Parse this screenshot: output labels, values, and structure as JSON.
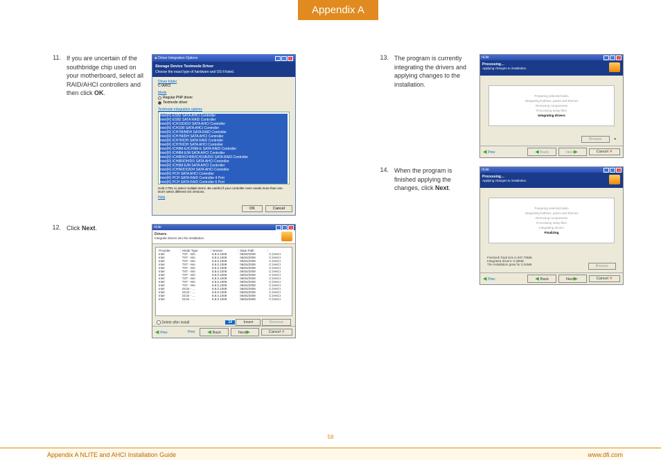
{
  "header": {
    "title": "Appendix A"
  },
  "steps": {
    "s11": {
      "num": "11.",
      "text_a": "If you are uncertain of the southbridge chip used on your motherboard, select all RAID/AHCI controllers and then click ",
      "text_b": "OK",
      "text_c": "."
    },
    "s12": {
      "num": "12.",
      "text_a": "Click ",
      "text_b": "Next",
      "text_c": "."
    },
    "s13": {
      "num": "13.",
      "text_a": "The program is currently integrating the drivers and applying changes to the installation."
    },
    "s14": {
      "num": "14.",
      "text_a": "When the program is finished applying the changes, click ",
      "text_b": "Next",
      "text_c": "."
    }
  },
  "win11": {
    "title": "Driver Integration Options",
    "h": "Storage Device Textmode Driver",
    "sub": "Choose the exact type of hardware and OS if listed.",
    "folder_lbl": "Driver folder",
    "folder": "C:\\AHCI",
    "mode_lbl": "Mode",
    "radio1": "Regular PNP driver",
    "radio2": "Textmode driver",
    "list_lbl": "Textmode integration options",
    "items": [
      "Intel(R) ESB2 SATA AHCI Controller",
      "Intel(R) ESB2 SATA RAID Controller",
      "Intel(R) ICH10D/DO SATA AHCI Controller",
      "Intel(R) ICH10R SATA AHCI Controller",
      "Intel(R) ICH7M/MDH SATA RAID Controller",
      "Intel(R) ICH7M/DH SATA AHCI Controller",
      "Intel(R) ICH7R/DH SATA RAID Controller",
      "Intel(R) ICH7R/DH SATA AHCI Controller",
      "Intel(R) ICH8M-E/ICH9M-E SATA RAID Controller",
      "Intel(R) ICH8M-E/M SATA AHCI Controller",
      "Intel(R) ICH8R/ICH9R/ICH10R/DO SATA RAID Controller",
      "Intel(R) ICH8R/DH/DO SATA AHCI Controller",
      "Intel(R) ICH9M-E/M SATA AHCI Controller",
      "Intel(R) ICH9R/DO/DH SATA AHCI Controller",
      "Intel(R) PCH SATA AHCI Controller",
      "Intel(R) PCH SATA RAID Controller 4 Port",
      "Intel(R) PCH SATA RAID Controller 6 Port"
    ],
    "hint": "Hold CTRL to select multiple items. Be careful if your controller even needs more than one. Don't select different OS versions.",
    "help": "Help",
    "ok": "OK",
    "cancel": "Cancel"
  },
  "win12": {
    "title": "nLite",
    "h": "Drivers",
    "sub": "Integrate drivers into the installation.",
    "rows": [
      [
        "Intel",
        "TXT - MA",
        "8.8.0.1009",
        "06/04/2009",
        "C:\\AHCI"
      ],
      [
        "Intel",
        "TXT - MA",
        "8.8.0.1009",
        "06/04/2009",
        "C:\\AHCI"
      ],
      [
        "Intel",
        "TXT - MA",
        "8.8.0.1009",
        "06/04/2009",
        "C:\\AHCI"
      ],
      [
        "Intel",
        "TXT - MA",
        "8.8.0.1009",
        "06/04/2009",
        "C:\\AHCI"
      ],
      [
        "Intel",
        "TXT - MA",
        "8.8.0.1009",
        "06/04/2009",
        "C:\\AHCI"
      ],
      [
        "Intel",
        "TXT - MA",
        "8.8.0.1009",
        "06/04/2009",
        "C:\\AHCI"
      ],
      [
        "Intel",
        "TXT - MA",
        "8.8.0.1009",
        "06/04/2009",
        "C:\\AHCI"
      ],
      [
        "Intel",
        "TXT - MA",
        "8.8.0.1009",
        "06/04/2009",
        "C:\\AHCI"
      ],
      [
        "Intel",
        "TXT - MA",
        "8.8.0.1009",
        "06/04/2009",
        "C:\\AHCI"
      ],
      [
        "Intel",
        "TXT - MA",
        "8.8.0.1009",
        "06/04/2009",
        "C:\\AHCI"
      ],
      [
        "Intel",
        "SCSI - …",
        "8.8.0.1009",
        "06/04/2009",
        "C:\\AHCI"
      ],
      [
        "Intel",
        "SCSI - …",
        "8.8.0.1009",
        "06/04/2009",
        "C:\\AHCI"
      ],
      [
        "Intel",
        "SCSI - …",
        "8.8.0.1009",
        "06/04/2009",
        "C:\\AHCI"
      ],
      [
        "Intel",
        "SCSI - …",
        "8.8.0.1009",
        "06/04/2009",
        "C:\\AHCI"
      ]
    ],
    "cols": [
      "Provider",
      "Mode   Type",
      "Version",
      "Date   Path"
    ],
    "chk": "Delete after install",
    "count": "14",
    "insert": "Insert",
    "remove": "Remove",
    "prev": "Prev",
    "back": "Back",
    "next": "Next",
    "cancel": "Cancel"
  },
  "win_proc": {
    "title": "nLite",
    "h": "Processing…",
    "sub": "Applying changes to installation.",
    "steps": [
      "Preparing selected tasks",
      "Integrating hotfixes, packs and themes",
      "Removing components",
      "Processing setup files",
      "Integrating drivers",
      "Finalizing"
    ],
    "cur13": 4,
    "cur14": 5,
    "stat1": "Finished! Total size is 607.79MB.",
    "stat2": "Integrated drivers: 0.39MB",
    "stat3": "The installation grew for 0.34MB",
    "browse": "Browse",
    "prev": "Prev",
    "back": "Back",
    "next": "Next",
    "cancel": "Cancel"
  },
  "footer": {
    "page": "58",
    "left": "Appendix A NLITE and AHCI Installation Guide",
    "right": "www.dfi.com"
  }
}
